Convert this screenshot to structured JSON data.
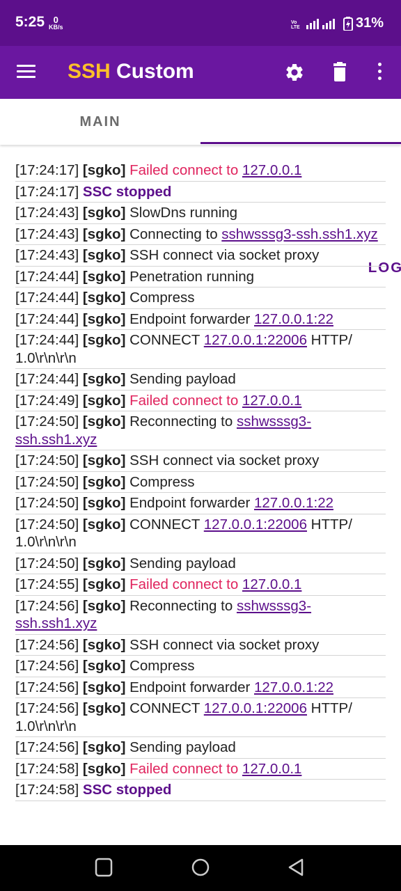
{
  "status_bar": {
    "time": "5:25",
    "kb_value": "0",
    "kb_unit": "KB/s",
    "battery": "31%"
  },
  "app_bar": {
    "title_part1": "SSH",
    "title_part2": " Custom"
  },
  "tabs": [
    {
      "label": "MAIN"
    },
    {
      "label": "LOG"
    }
  ],
  "log": [
    {
      "time": "[17:24:17] ",
      "tag": "[sgko] ",
      "text": "Failed connect to ",
      "link": "127.0.0.1",
      "type": "fail"
    },
    {
      "time": "[17:24:17] ",
      "text": "SSC stopped",
      "type": "stopped"
    },
    {
      "time": "[17:24:43] ",
      "tag": "[sgko] ",
      "text": "SlowDns running"
    },
    {
      "time": "[17:24:43] ",
      "tag": "[sgko] ",
      "text": "Connecting to ",
      "link": "sshwsssg3-ssh.ssh1.xyz"
    },
    {
      "time": "[17:24:43] ",
      "tag": "[sgko] ",
      "text": "SSH connect via socket proxy"
    },
    {
      "time": "[17:24:44] ",
      "tag": "[sgko] ",
      "text": "Penetration running"
    },
    {
      "time": "[17:24:44] ",
      "tag": "[sgko] ",
      "text": "Compress"
    },
    {
      "time": "[17:24:44] ",
      "tag": "[sgko] ",
      "text": "Endpoint forwarder ",
      "link": "127.0.0.1:22"
    },
    {
      "time": "[17:24:44] ",
      "tag": "[sgko] ",
      "text": "CONNECT ",
      "link": "127.0.0.1:22006",
      "after": " HTTP/ 1.0\\r\\n\\r\\n"
    },
    {
      "time": "[17:24:44] ",
      "tag": "[sgko] ",
      "text": "Sending payload"
    },
    {
      "time": "[17:24:49] ",
      "tag": "[sgko] ",
      "text": "Failed connect to ",
      "link": "127.0.0.1",
      "type": "fail"
    },
    {
      "time": "[17:24:50] ",
      "tag": "[sgko] ",
      "text": "Reconnecting to ",
      "link": "sshwsssg3-ssh.ssh1.xyz"
    },
    {
      "time": "[17:24:50] ",
      "tag": "[sgko] ",
      "text": "SSH connect via socket proxy"
    },
    {
      "time": "[17:24:50] ",
      "tag": "[sgko] ",
      "text": "Compress"
    },
    {
      "time": "[17:24:50] ",
      "tag": "[sgko] ",
      "text": "Endpoint forwarder ",
      "link": "127.0.0.1:22"
    },
    {
      "time": "[17:24:50] ",
      "tag": "[sgko] ",
      "text": "CONNECT ",
      "link": "127.0.0.1:22006",
      "after": " HTTP/ 1.0\\r\\n\\r\\n"
    },
    {
      "time": "[17:24:50] ",
      "tag": "[sgko] ",
      "text": "Sending payload"
    },
    {
      "time": "[17:24:55] ",
      "tag": "[sgko] ",
      "text": "Failed connect to ",
      "link": "127.0.0.1",
      "type": "fail"
    },
    {
      "time": "[17:24:56] ",
      "tag": "[sgko] ",
      "text": "Reconnecting to ",
      "link": "sshwsssg3-ssh.ssh1.xyz"
    },
    {
      "time": "[17:24:56] ",
      "tag": "[sgko] ",
      "text": "SSH connect via socket proxy"
    },
    {
      "time": "[17:24:56] ",
      "tag": "[sgko] ",
      "text": "Compress"
    },
    {
      "time": "[17:24:56] ",
      "tag": "[sgko] ",
      "text": "Endpoint forwarder ",
      "link": "127.0.0.1:22"
    },
    {
      "time": "[17:24:56] ",
      "tag": "[sgko] ",
      "text": "CONNECT ",
      "link": "127.0.0.1:22006",
      "after": " HTTP/ 1.0\\r\\n\\r\\n"
    },
    {
      "time": "[17:24:56] ",
      "tag": "[sgko] ",
      "text": "Sending payload"
    },
    {
      "time": "[17:24:58] ",
      "tag": "[sgko] ",
      "text": "Failed connect to ",
      "link": "127.0.0.1",
      "type": "fail"
    },
    {
      "time": "[17:24:58] ",
      "text": "SSC stopped",
      "type": "stopped"
    }
  ],
  "icons": {
    "menu": "hamburger-icon",
    "settings": "gear-icon",
    "delete": "trash-icon",
    "more": "more-vert-icon"
  },
  "colors": {
    "status_bar": "#5c0f8b",
    "app_bar": "#6a17a0",
    "title_accent": "#ffc02a",
    "error": "#e0245e",
    "accent": "#5c0f8b"
  }
}
